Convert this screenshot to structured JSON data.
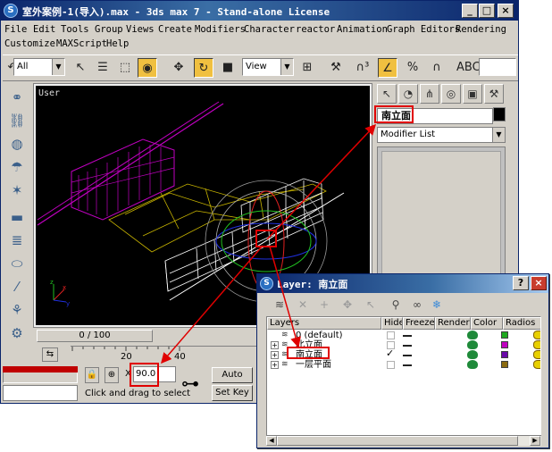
{
  "window": {
    "title": "室外案例-1(导入).max - 3ds max 7 - Stand-alone License",
    "min": "_",
    "max": "□",
    "close": "×"
  },
  "menu": {
    "row1": [
      "File",
      "Edit",
      "Tools",
      "Group",
      "Views",
      "Create",
      "Modifiers",
      "Character",
      "reactor",
      "Animation",
      "Graph Editors",
      "Rendering"
    ],
    "row2": [
      "Customize",
      "MAXScript",
      "Help"
    ]
  },
  "toolbar": {
    "selection_filter": "All",
    "ref_coord": "View"
  },
  "viewport": {
    "label": "User"
  },
  "command_panel": {
    "object_name": "南立面",
    "modifier_list": "Modifier List"
  },
  "timeline": {
    "slider": "0 / 100",
    "ticks": [
      "20",
      "40"
    ]
  },
  "status": {
    "x_label": "X",
    "x_value": "90.0",
    "prompt": "Click and drag to select",
    "auto_key": "Auto Key",
    "set_key": "Set Key"
  },
  "layer_dialog": {
    "title": "Layer: 南立面",
    "help": "?",
    "close": "×",
    "columns": [
      "Layers",
      "Hide",
      "Freeze",
      "Render",
      "Color",
      "Radios"
    ],
    "layers": [
      {
        "name": "0 (default)",
        "color": "#1fa81f",
        "current": false
      },
      {
        "name": "北立面",
        "color": "#c000c0",
        "current": false
      },
      {
        "name": "南立面",
        "color": "#6a0aa8",
        "current": true
      },
      {
        "name": "一层平面",
        "color": "#8a6a10",
        "current": false
      }
    ]
  },
  "colors": {
    "title_bg": "#0a246a",
    "highlight": "#e00000",
    "panel": "#d4d0c8"
  }
}
